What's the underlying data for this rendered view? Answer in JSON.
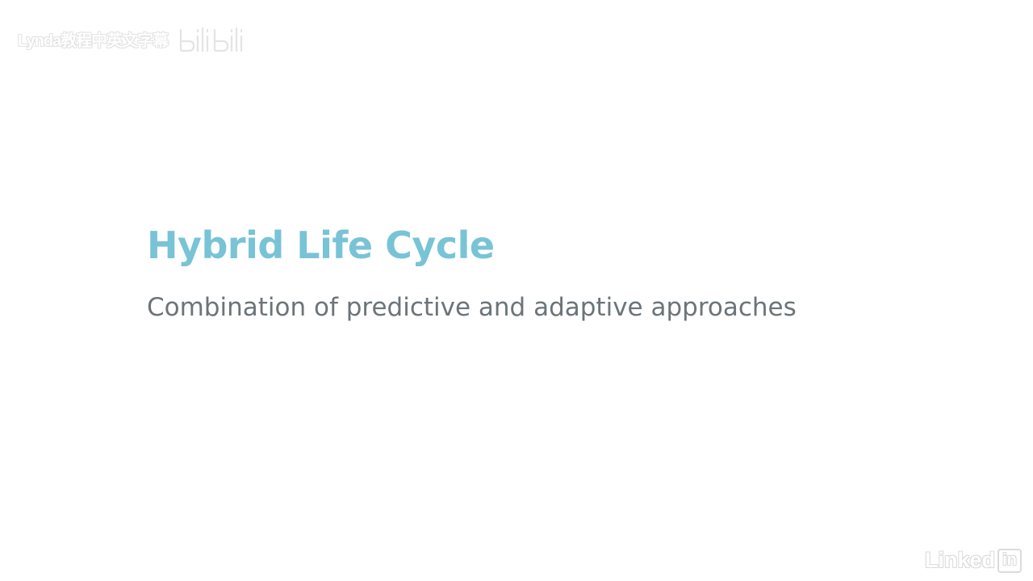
{
  "watermark": {
    "text": "Lynda教程中英文字幕",
    "logo_icon": "bilibili-logo-icon"
  },
  "slide": {
    "title": "Hybrid Life Cycle",
    "subtitle": "Combination of predictive and adaptive approaches",
    "title_color": "#79c3d6",
    "subtitle_color": "#6b7479",
    "background": "#ffffff"
  },
  "brand": {
    "word": "Linked",
    "box": "in",
    "icon": "linkedin-logo-icon"
  }
}
